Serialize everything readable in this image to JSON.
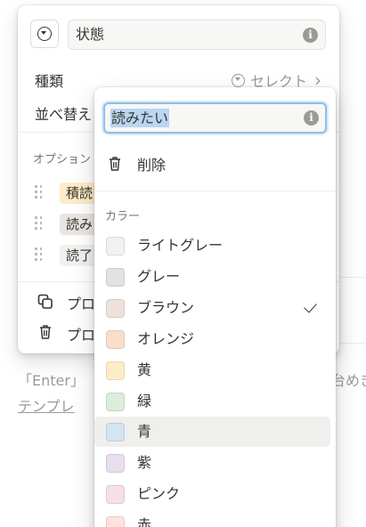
{
  "background": {
    "hint_left": "「Enter」",
    "hint_right": "台めき",
    "link_text": "テンプレ"
  },
  "property": {
    "name": "状態",
    "type_label": "種類",
    "type_value": "セレクト",
    "type_chevron": "›",
    "sort_label": "並べ替え",
    "options_section": "オプション",
    "options": [
      {
        "label": "積読",
        "color": "#fdecc8"
      },
      {
        "label": "読み",
        "color": "#e9e5e3"
      },
      {
        "label": "読了",
        "color": "#f1f1ef"
      }
    ],
    "actions": [
      {
        "label": "プロ",
        "icon": "duplicate-icon"
      },
      {
        "label": "プロ",
        "icon": "trash-icon"
      }
    ]
  },
  "option_editor": {
    "name_value": "読みたい",
    "delete_label": "削除",
    "color_section": "カラー",
    "selected_color": "ブラウン",
    "hovered_color": "青",
    "colors": [
      {
        "name": "ライトグレー",
        "swatch": "#f1f1ef"
      },
      {
        "name": "グレー",
        "swatch": "#e3e2e0"
      },
      {
        "name": "ブラウン",
        "swatch": "#eee0da"
      },
      {
        "name": "オレンジ",
        "swatch": "#fadec9"
      },
      {
        "name": "黄",
        "swatch": "#fdecc8"
      },
      {
        "name": "緑",
        "swatch": "#dbeddb"
      },
      {
        "name": "青",
        "swatch": "#d3e5ef"
      },
      {
        "name": "紫",
        "swatch": "#e8deee"
      },
      {
        "name": "ピンク",
        "swatch": "#f5e0e9"
      },
      {
        "name": "赤",
        "swatch": "#ffe2dd"
      }
    ]
  }
}
